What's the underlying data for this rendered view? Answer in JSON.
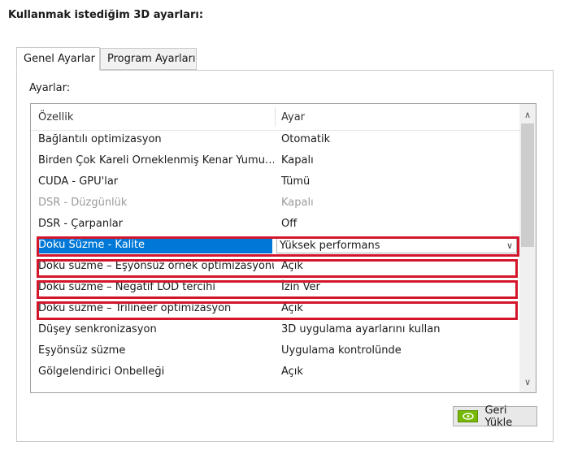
{
  "heading": "Kullanmak istediğim 3D ayarları:",
  "tabs": [
    {
      "label": "Genel Ayarlar",
      "active": true
    },
    {
      "label": "Program Ayarları",
      "active": false
    }
  ],
  "settings_label": "Ayarlar:",
  "columns": {
    "property": "Özellik",
    "value": "Ayar"
  },
  "rows": [
    {
      "property": "Bağlantılı optimizasyon",
      "value": "Otomatik"
    },
    {
      "property": "Birden Çok Kareli Örneklenmiş Kenar Yumu…",
      "value": "Kapalı"
    },
    {
      "property": "CUDA - GPU'lar",
      "value": "Tümü"
    },
    {
      "property": "DSR - Düzgünlük",
      "value": "Kapalı",
      "disabled": true
    },
    {
      "property": "DSR - Çarpanlar",
      "value": "Off"
    },
    {
      "property": "Doku Süzme - Kalite",
      "value": "Yüksek performans",
      "selected": true
    },
    {
      "property": "Doku süzme – Eşyönsüz örnek optimizasyonu",
      "value": "Açık"
    },
    {
      "property": "Doku süzme – Negatif LOD tercihi",
      "value": "İzin Ver"
    },
    {
      "property": "Doku süzme – Trilineer optimizasyon",
      "value": "Açık"
    },
    {
      "property": "Düşey senkronizasyon",
      "value": "3D uygulama ayarlarını kullan"
    },
    {
      "property": "Eşyönsüz süzme",
      "value": "Uygulama kontrolünde"
    },
    {
      "property": "Gölgelendirici Önbelleği",
      "value": "Açık"
    }
  ],
  "restore_button": "Geri Yükle",
  "colors": {
    "highlight": "#d3162c",
    "selection": "#0078d7",
    "nvidia": "#76b900"
  }
}
